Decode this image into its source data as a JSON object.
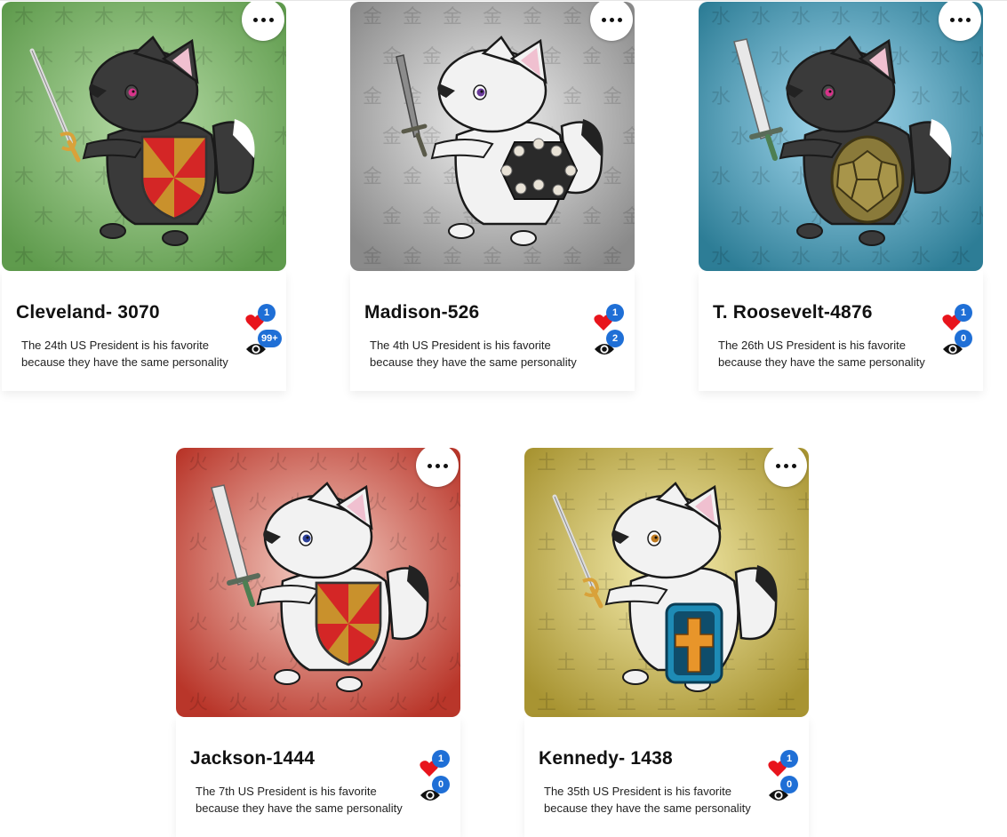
{
  "cards": [
    {
      "title": "Cleveland- 3070",
      "description": "The 24th US President is his favorite because they have the same personality",
      "likes": "1",
      "views": "99+",
      "element_glyph": "木",
      "bg_light": "#b7dca7",
      "bg_dark": "#5f9b4d",
      "fur": "#3a3a3a",
      "eye_color": "#d9338a",
      "shield": "heraldic-red-gold",
      "weapon": "rapier"
    },
    {
      "title": "Madison-526",
      "description": "The 4th US President is his favorite because they have the same personality",
      "likes": "1",
      "views": "2",
      "element_glyph": "金",
      "bg_light": "#f4f4f4",
      "bg_dark": "#8a8a8a",
      "fur": "#f2f2f2",
      "eye_color": "#6a3a9a",
      "shield": "skull-hexagon",
      "weapon": "longsword"
    },
    {
      "title": "T. Roosevelt-4876",
      "description": "The 26th US President is his favorite because they have the same personality",
      "likes": "1",
      "views": "0",
      "element_glyph": "水",
      "bg_light": "#a8dcf2",
      "bg_dark": "#2d7d96",
      "fur": "#3a3a3a",
      "eye_color": "#d9338a",
      "shield": "turtle-shell",
      "weapon": "broadsword"
    },
    {
      "title": "Jackson-1444",
      "description": "The 7th US President is his favorite because they have the same personality",
      "likes": "1",
      "views": "0",
      "element_glyph": "火",
      "bg_light": "#f6d2c8",
      "bg_dark": "#b9362a",
      "fur": "#f2f2f2",
      "eye_color": "#2b3f9a",
      "shield": "heraldic-red-gold",
      "weapon": "broadsword"
    },
    {
      "title": "Kennedy- 1438",
      "description": "The 35th US President is his favorite because they have the same personality",
      "likes": "1",
      "views": "0",
      "element_glyph": "土",
      "bg_light": "#f7efb0",
      "bg_dark": "#a89432",
      "fur": "#f2f2f2",
      "eye_color": "#c07a1e",
      "shield": "blue-cross",
      "weapon": "rapier"
    }
  ],
  "icons": {
    "more": "more-horizontal-icon",
    "like": "heart-icon",
    "views": "eye-icon"
  },
  "colors": {
    "badge": "#1f6fd6",
    "heart": "#e8141c"
  }
}
